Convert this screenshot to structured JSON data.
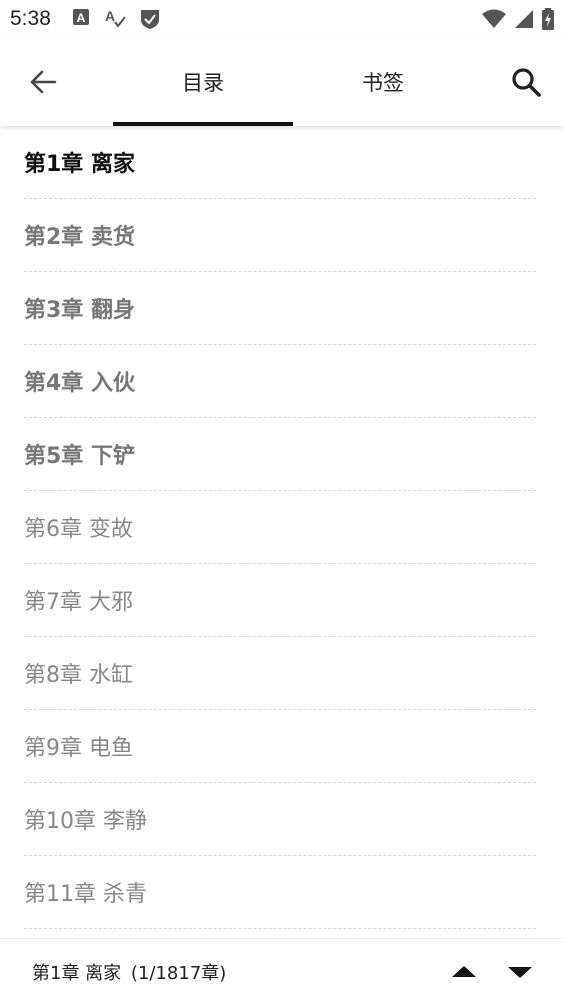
{
  "status_bar": {
    "time": "5:38",
    "icons_left": [
      "font-a-icon",
      "spellcheck-icon",
      "shield-check-icon"
    ],
    "icons_right": [
      "wifi-icon",
      "cell-signal-icon",
      "battery-charging-icon"
    ]
  },
  "toolbar": {
    "tabs": [
      {
        "label": "目录",
        "active": true
      },
      {
        "label": "书签",
        "active": false
      }
    ]
  },
  "chapters": [
    {
      "title": "第1章 离家",
      "state": "current"
    },
    {
      "title": "第2章 卖货",
      "state": "cached"
    },
    {
      "title": "第3章 翻身",
      "state": "cached"
    },
    {
      "title": "第4章 入伙",
      "state": "cached"
    },
    {
      "title": "第5章 下铲",
      "state": "cached"
    },
    {
      "title": "第6章 变故",
      "state": "normal"
    },
    {
      "title": "第7章 大邪",
      "state": "normal"
    },
    {
      "title": "第8章 水缸",
      "state": "normal"
    },
    {
      "title": "第9章 电鱼",
      "state": "normal"
    },
    {
      "title": "第10章 李静",
      "state": "normal"
    },
    {
      "title": "第11章 杀青",
      "state": "normal"
    }
  ],
  "bottom_bar": {
    "current_chapter": "第1章 离家",
    "page_info": "(1/1817章)"
  },
  "colors": {
    "current": "#111111",
    "cached": "#777777",
    "normal": "#888888"
  }
}
